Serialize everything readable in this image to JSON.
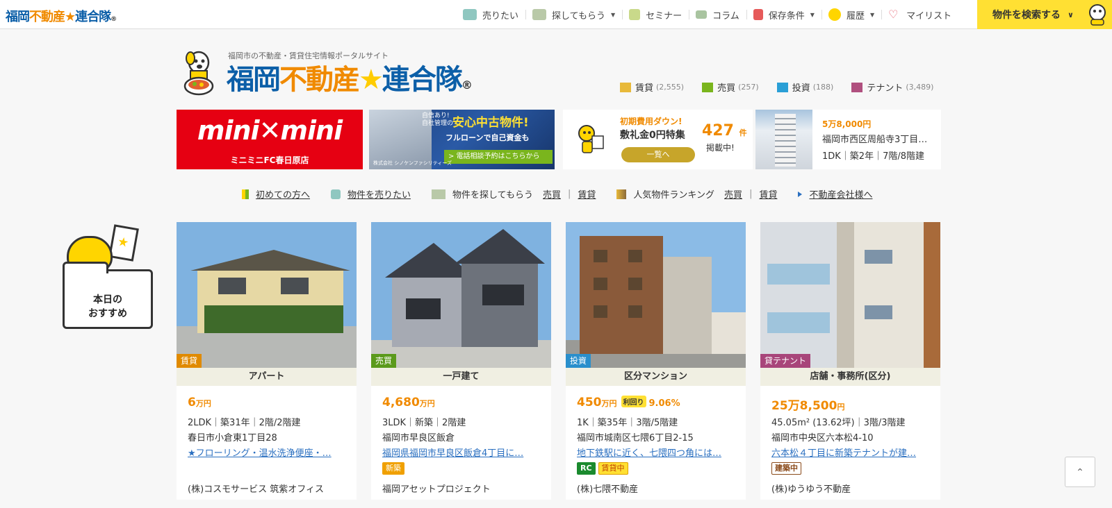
{
  "topnav": {
    "logo_a": "福岡",
    "logo_b": "不動産",
    "logo_star": "★",
    "logo_c": "連合隊",
    "logo_reg": "®",
    "items": [
      {
        "label": "売りたい",
        "icon": "yen-icon",
        "caret": ""
      },
      {
        "label": "探してもらう",
        "icon": "envelope-icon",
        "caret": "▼"
      },
      {
        "label": "セミナー",
        "icon": "seminar-icon",
        "caret": ""
      },
      {
        "label": "コラム",
        "icon": "column-icon",
        "caret": ""
      },
      {
        "label": "保存条件",
        "icon": "download-icon",
        "caret": "▼"
      },
      {
        "label": "履歴",
        "icon": "history-icon",
        "caret": "▼"
      },
      {
        "label": "マイリスト",
        "icon": "heart-icon",
        "caret": ""
      }
    ],
    "search_label": "物件を検索する",
    "search_chevron": "∨"
  },
  "header": {
    "tagline": "福岡市の不動産・賃貸住宅情報ポータルサイト",
    "logo_a": "福岡",
    "logo_b": "不動産",
    "logo_star": "★",
    "logo_c": "連合隊",
    "logo_reg": "®"
  },
  "categories": [
    {
      "label": "賃貸",
      "count": "(2,555)",
      "color": "#e8b93a"
    },
    {
      "label": "売買",
      "count": "(257)",
      "color": "#7ab51d"
    },
    {
      "label": "投資",
      "count": "(188)",
      "color": "#2a9fd6"
    },
    {
      "label": "テナント",
      "count": "(3,489)",
      "color": "#b0507f"
    }
  ],
  "banners": {
    "minimini": {
      "title": "mini✕mini",
      "sub": "ミニミニFC春日原店"
    },
    "shinken": {
      "l1a": "自信あり!",
      "l1b": "自社管理の",
      "l2": "安心中古物件!",
      "l3": "フルローンで自己資金も",
      "l4": "> 電話相談予約はこちらから",
      "co": "株式会社 シノケンファシリティーズ"
    },
    "shikikin": {
      "t1": "初期費用ダウン!",
      "t2": "敷礼金0円特集",
      "num": "427",
      "num_unit": "件",
      "t3": "掲載中!",
      "btn": "一覧へ"
    },
    "featured": {
      "price": "5万8,000円",
      "addr": "福岡市西区周船寺3丁目…",
      "spec": "1DK｜築2年｜7階/8階建"
    }
  },
  "subnav": {
    "first": "初めての方へ",
    "sell": "物件を売りたい",
    "find": "物件を探してもらう",
    "find_a": "売買",
    "find_b": "賃貸",
    "rank": "人気物件ランキング",
    "rank_a": "売買",
    "rank_b": "賃貸",
    "agent": "不動産会社様へ",
    "sep": "|"
  },
  "recommend": {
    "line1": "本日の",
    "line2": "おすすめ"
  },
  "cards": [
    {
      "tag": "賃貸",
      "tag_color": "#e08a00",
      "type": "アパート",
      "price_num": "6",
      "price_unit": "万円",
      "yield_label": "",
      "yield_value": "",
      "spec": "2LDK｜築31年｜2階/2階建",
      "addr": "春日市小倉東1丁目28",
      "desc": "★フローリング・温水洗浄便座・…",
      "badges": [],
      "agent": "(株)コスモサービス 筑紫オフィス"
    },
    {
      "tag": "売買",
      "tag_color": "#5b9a1c",
      "type": "一戸建て",
      "price_num": "4,680",
      "price_unit": "万円",
      "yield_label": "",
      "yield_value": "",
      "spec": "3LDK｜新築｜2階建",
      "addr": "福岡市早良区飯倉",
      "desc": "福岡県福岡市早良区飯倉4丁目に…",
      "badges": [
        {
          "text": "新築",
          "bg": "#f0a000",
          "fg": "#fff",
          "bd": "#f0a000"
        }
      ],
      "agent": "福岡アセットプロジェクト"
    },
    {
      "tag": "投資",
      "tag_color": "#2a8fcc",
      "type": "区分マンション",
      "price_num": "450",
      "price_unit": "万円",
      "yield_label": "利回り",
      "yield_value": "9.06%",
      "spec": "1K｜築35年｜3階/5階建",
      "addr": "福岡市城南区七隈6丁目2-15",
      "desc": "地下鉄駅に近く、七隈四つ角には…",
      "badges": [
        {
          "text": "RC",
          "bg": "#1a8a2e",
          "fg": "#fff",
          "bd": "#1a8a2e"
        },
        {
          "text": "賃貸中",
          "bg": "#ffe033",
          "fg": "#c04000",
          "bd": "#e0a000"
        }
      ],
      "agent": "(株)七隈不動産"
    },
    {
      "tag": "貸テナント",
      "tag_color": "#a8457a",
      "type": "店舗・事務所(区分)",
      "price_num": "25万8,500",
      "price_unit": "円",
      "yield_label": "",
      "yield_value": "",
      "spec": "45.05m² (13.62坪)｜3階/3階建",
      "addr": "福岡市中央区六本松4-10",
      "desc": "六本松４丁目に新築テナントが建…",
      "badges": [
        {
          "text": "建築中",
          "bg": "#fff",
          "fg": "#8a4a1a",
          "bd": "#8a4a1a"
        }
      ],
      "agent": "(株)ゆうゆう不動産"
    }
  ],
  "scrolltop": "⌃"
}
